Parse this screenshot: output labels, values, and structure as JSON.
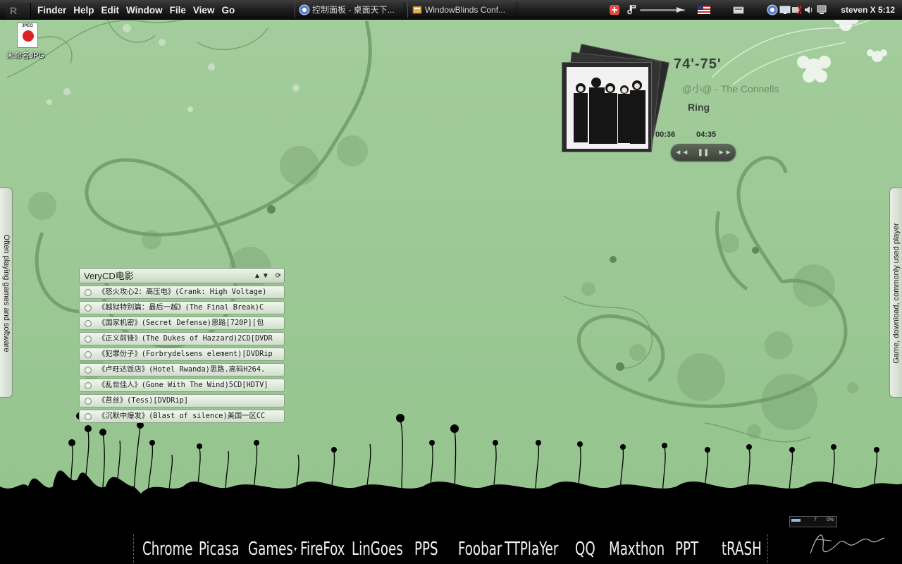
{
  "menubar": {
    "logo": "R",
    "menus": [
      "Finder",
      "Help",
      "Edit",
      "Window",
      "File",
      "View",
      "Go"
    ],
    "tasks": [
      {
        "label": "控制面板 - 桌面天下...",
        "icon": "control-panel-icon"
      },
      {
        "label": "WindowBlinds Conf...",
        "icon": "windowblinds-icon"
      }
    ],
    "clock": "steven X 5:12",
    "tray_icons": [
      "add-icon",
      "music-note-icon",
      "volume-slider",
      "us-flag-icon",
      "keyboard-icon",
      "network-icon",
      "display-icon",
      "wireless-icon",
      "speaker-icon",
      "monitor-icon"
    ]
  },
  "desktop": {
    "icon_label": "未命名JPG",
    "icon_type": "JPEG",
    "icon_name": "jpeg-file-icon"
  },
  "drawers": {
    "left": "Often playing games and software",
    "right": "Game, download, commonly used player"
  },
  "rss": {
    "title": "VeryCD电影",
    "controls": {
      "up": "▲",
      "down": "▼",
      "refresh": "⟳"
    },
    "items": [
      "《怒火攻心2：高压电》(Crank: High Voltage)",
      "《越狱特别篇：最后一越》(The Final Break)C",
      "《国家机密》(Secret Defense)思路[720P][包",
      "《正义前锋》(The Dukes of Hazzard)2CD[DVDR",
      "《犯罪份子》(Forbrydelsens element)[DVDRip",
      "《卢旺达饭店》(Hotel Rwanda)思路.高码H264.",
      "《乱世佳人》(Gone With The Wind)5CD[HDTV]",
      "《苔丝》(Tess)[DVDRip]",
      "《沉默中爆发》(Blast of silence)美国一区CC"
    ]
  },
  "player": {
    "title": "74'-75'",
    "artist": "@小@ - The Connells",
    "album": "Ring",
    "elapsed": "00:36",
    "total": "04:35",
    "progress": 0.13,
    "controls": {
      "prev": "◄◄",
      "pause": "❚❚",
      "next": "►►"
    }
  },
  "dock": {
    "items": [
      "Chrome",
      "Picasa",
      "Games",
      "FireFox",
      "LinGoes",
      "PPS",
      "Foobar",
      "TTPlaYer",
      "QQ",
      "Maxthon",
      "PPT",
      "tRASH"
    ],
    "games_arrow": "▾"
  },
  "meter": {
    "left": "7",
    "right": "0%",
    "level": 0.2
  },
  "colors": {
    "wallpaper": "#9ec998",
    "menubar": "#1c1c1c",
    "dock": "#000000",
    "swirl": "#6f9a69",
    "text_on_dark": "#f1f1f1"
  }
}
